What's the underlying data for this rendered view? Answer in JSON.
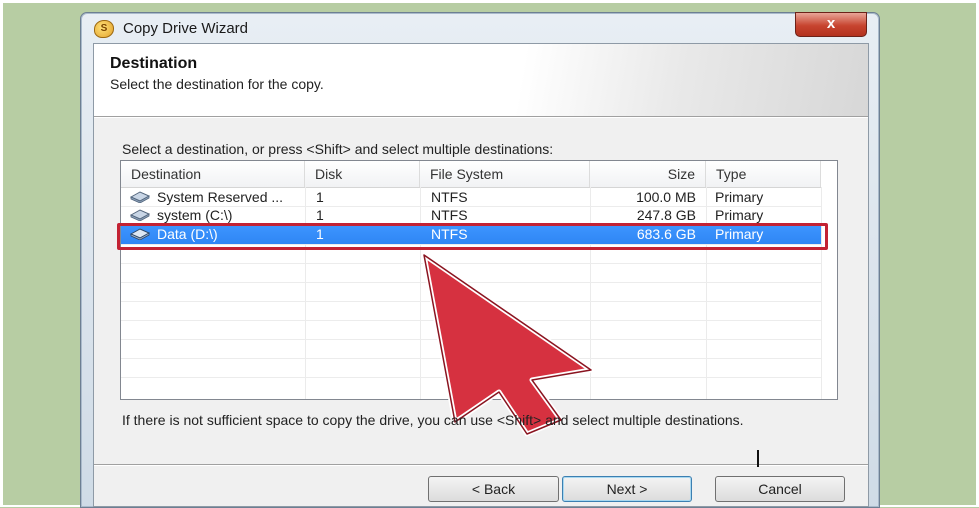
{
  "window": {
    "title": "Copy Drive Wizard",
    "close_label": "x"
  },
  "header": {
    "title": "Destination",
    "subtitle": "Select the destination for the copy."
  },
  "instruction": "Select a destination, or press <Shift> and select multiple destinations:",
  "table": {
    "columns": [
      "Destination",
      "Disk",
      "File System",
      "Size",
      "Type"
    ],
    "rows": [
      {
        "destination": "System Reserved ...",
        "disk": "1",
        "fs": "NTFS",
        "size": "100.0 MB",
        "type": "Primary"
      },
      {
        "destination": "system (C:\\)",
        "disk": "1",
        "fs": "NTFS",
        "size": "247.8 GB",
        "type": "Primary"
      },
      {
        "destination": "Data (D:\\)",
        "disk": "1",
        "fs": "NTFS",
        "size": "683.6 GB",
        "type": "Primary"
      }
    ],
    "selected_row": 2
  },
  "footnote": "If there is not sufficient space to copy the drive, you can use <Shift> and select multiple destinations.",
  "buttons": {
    "back": "< Back",
    "next": "Next >",
    "cancel": "Cancel"
  },
  "colors": {
    "selection": "#3d95ff",
    "annotation_red": "#c32233",
    "background": "#b7cda3"
  },
  "icons": {
    "app": "wizard-app-icon",
    "drive": "hard-drive-icon",
    "pointer": "red-arrow-pointer"
  }
}
